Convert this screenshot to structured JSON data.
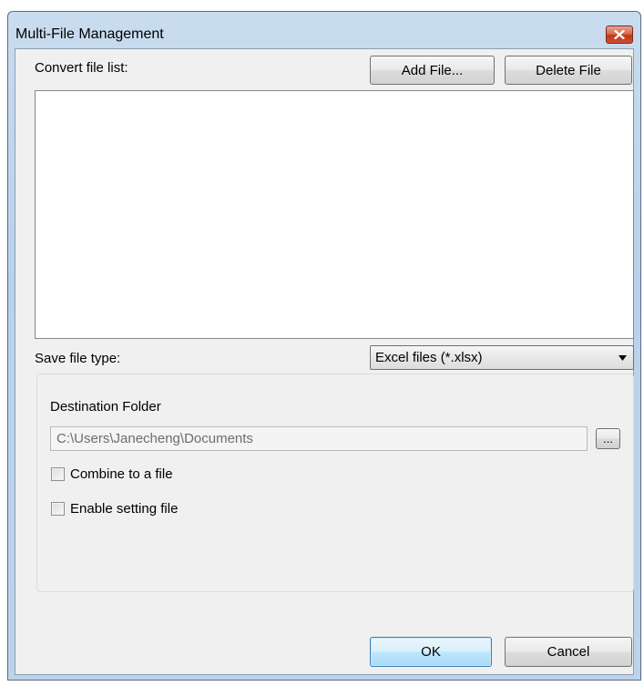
{
  "window": {
    "title": "Multi-File Management"
  },
  "file_list": {
    "label": "Convert file list:",
    "add_button": "Add File...",
    "delete_button": "Delete File",
    "items": []
  },
  "save_type": {
    "label": "Save file type:",
    "selected": "Excel files (*.xlsx)"
  },
  "destination": {
    "label": "Destination Folder",
    "path": "C:\\Users\\Janecheng\\Documents",
    "browse_label": "..."
  },
  "options": {
    "combine_label": "Combine to a file",
    "combine_checked": false,
    "setting_label": "Enable setting file",
    "setting_checked": false
  },
  "footer": {
    "ok_label": "OK",
    "cancel_label": "Cancel"
  },
  "colors": {
    "title_bar": "#b9d1ea",
    "close_button": "#c7452a",
    "dialog_bg": "#f0f0f0",
    "default_button_border": "#3c7fb1"
  }
}
